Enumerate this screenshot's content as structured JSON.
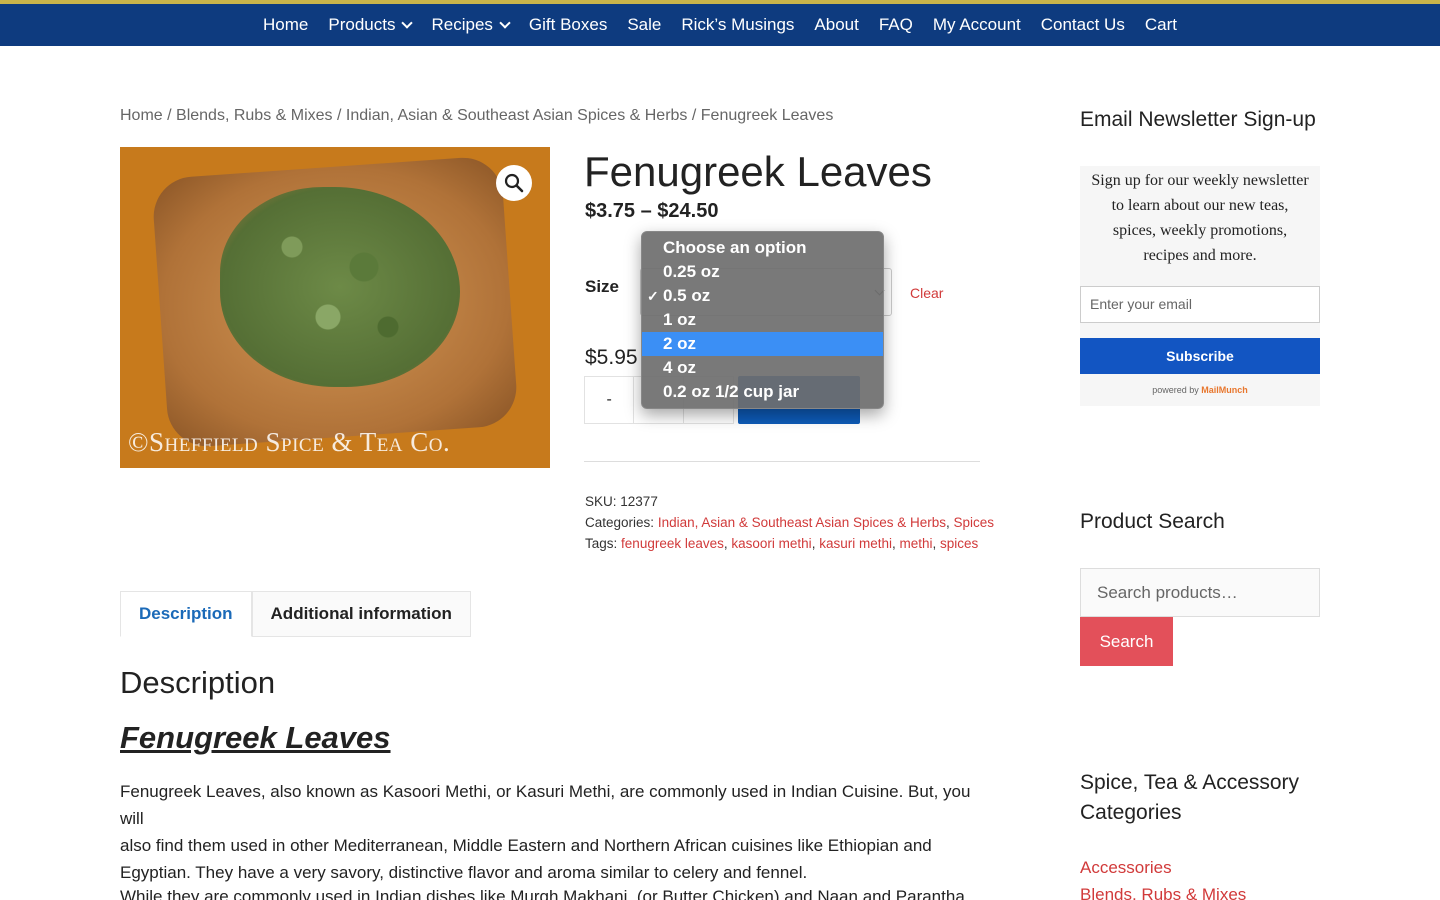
{
  "nav": {
    "items": [
      {
        "label": "Home"
      },
      {
        "label": "Products",
        "dropdown": true
      },
      {
        "label": "Recipes",
        "dropdown": true
      },
      {
        "label": "Gift Boxes"
      },
      {
        "label": "Sale"
      },
      {
        "label": "Rick’s Musings"
      },
      {
        "label": "About"
      },
      {
        "label": "FAQ"
      },
      {
        "label": "My Account"
      },
      {
        "label": "Contact Us"
      },
      {
        "label": "Cart"
      }
    ]
  },
  "breadcrumb": {
    "home": "Home",
    "sep": " / ",
    "level1": "Blends, Rubs & Mixes",
    "level2": "Indian, Asian & Southeast Asian Spices & Herbs",
    "current": "Fenugreek Leaves"
  },
  "product": {
    "image_watermark": "©Sheffield Spice & Tea Co.",
    "title": "Fenugreek Leaves",
    "price_range": "$3.75 – $24.50",
    "size_label": "Size",
    "clear_label": "Clear",
    "variation_price": "$5.95",
    "qty_minus": "-",
    "sku_label": "SKU:",
    "sku": "12377",
    "categories_label": "Categories:",
    "categories": [
      "Indian, Asian & Southeast Asian Spices & Herbs",
      "Spices"
    ],
    "tags_label": "Tags:",
    "tags": [
      "fenugreek leaves",
      "kasoori methi",
      "kasuri methi",
      "methi",
      "spices"
    ]
  },
  "size_dropdown": {
    "selected": "0.5 oz",
    "highlighted": "2 oz",
    "options": [
      "Choose an option",
      "0.25 oz",
      "0.5 oz",
      "1 oz",
      "2 oz",
      "4 oz",
      "0.2 oz 1/2 cup jar"
    ]
  },
  "tabs": [
    {
      "label": "Description",
      "active": true
    },
    {
      "label": "Additional information",
      "active": false
    }
  ],
  "description": {
    "heading": "Description",
    "subheading": "Fenugreek Leaves",
    "paragraph1_lines": [
      "Fenugreek Leaves, also known as Kasoori Methi, or Kasuri Methi, are commonly used in Indian Cuisine. But, you will",
      "also find them used in other Mediterranean, Middle Eastern and Northern African cuisines like Ethiopian and",
      "Egyptian. They have a very savory, distinctive flavor and aroma similar to celery and fennel."
    ],
    "paragraph2_partial": "While they are commonly used in Indian dishes like Murgh Makhani, (or Butter Chicken) and Naan and Parantha"
  },
  "sidebar": {
    "newsletter": {
      "title": "Email Newsletter Sign-up",
      "text_lines": [
        "Sign up for our weekly newsletter",
        "to learn about our new teas,",
        "spices, weekly promotions,",
        "recipes and more."
      ],
      "email_placeholder": "Enter your email",
      "subscribe_label": "Subscribe",
      "powered_prefix": "powered by",
      "powered_brand": "MailMunch"
    },
    "search": {
      "title": "Product Search",
      "placeholder": "Search products…",
      "button_label": "Search"
    },
    "categories": {
      "title_line1": "Spice, Tea & Accessory",
      "title_line2": "Categories",
      "items": [
        "Accessories",
        "Blends, Rubs & Mixes"
      ]
    }
  },
  "colors": {
    "nav_bg": "#0e3b7f",
    "accent_link": "#d13a3a",
    "subscribe_bg": "#1255c2",
    "search_btn_bg": "#e3505a",
    "dropdown_highlight": "#3b8ff5"
  }
}
